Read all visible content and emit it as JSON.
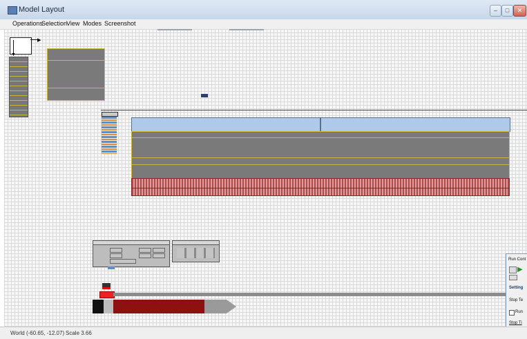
{
  "window": {
    "title": "Model Layout"
  },
  "menu": {
    "items": [
      "Operations",
      "Selection",
      "View",
      "Modes",
      "Screenshot"
    ]
  },
  "status": {
    "world": "World (-60.65, -12.07)",
    "scale": "Scale 3.66"
  },
  "run_panel": {
    "title": "Run Cont",
    "settings": "Setting",
    "stop_te": "Stop Te",
    "run_cb": "Run",
    "stop_ti": "Stop Ti"
  },
  "colors": {
    "block_gray": "#7a7a7a",
    "block_border": "#c9b63c",
    "blue_header": "#aec9ea",
    "hatch": "#b34a4a",
    "track": "#8c8c8c",
    "red": "#8e1111"
  }
}
